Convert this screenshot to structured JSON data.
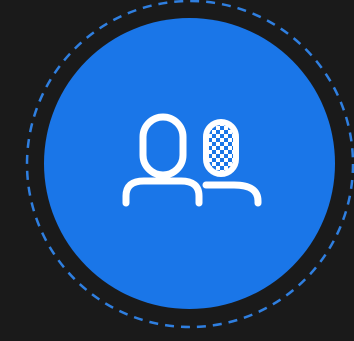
{
  "colors": {
    "background": "#1a1a1a",
    "ring": "#2f7fe0",
    "button_fill": "#1a76e8",
    "icon": "#ffffff"
  },
  "control": {
    "icon": "users-masked-icon",
    "ring_style": "dashed"
  }
}
